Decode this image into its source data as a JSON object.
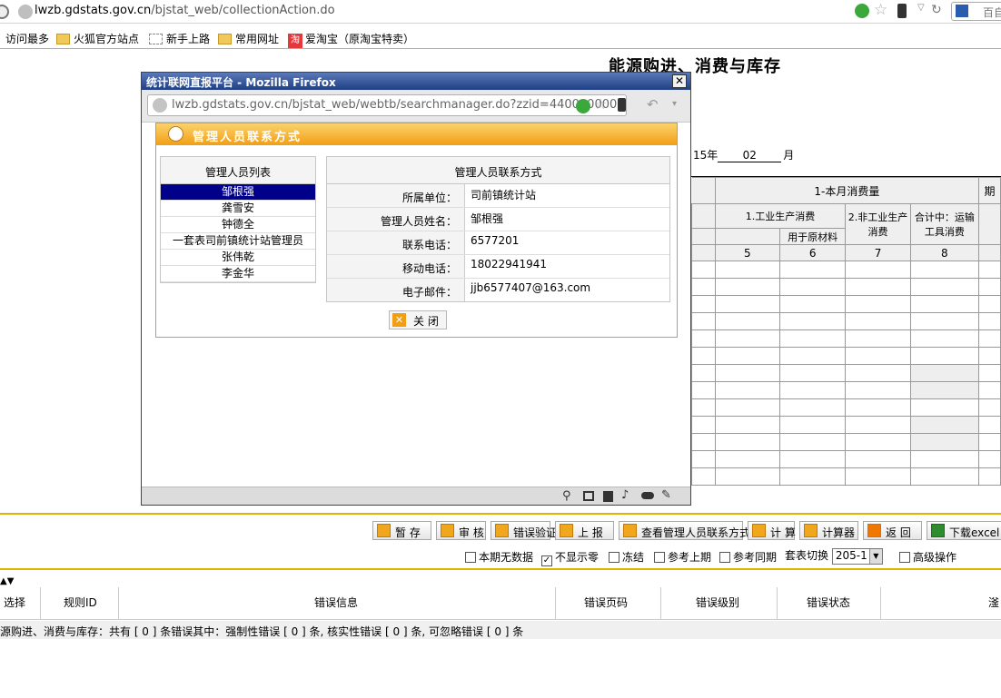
{
  "browser": {
    "url_domain": "lwzb.gdstats.gov.cn",
    "url_path": "/bjstat_web/collectionAction.do",
    "search_hint": "百自",
    "bookmarks": [
      "访问最多",
      "火狐官方站点",
      "新手上路",
      "常用网址",
      "爱淘宝（原淘宝特卖）"
    ],
    "taobao_badge": "淘"
  },
  "page": {
    "title": "能源购进、消费与库存",
    "period_year": "15年",
    "period_month_value": "02",
    "period_month_unit": "月",
    "grid": {
      "group_header": "1-本月消费量",
      "partial_header": "期",
      "col1": "1.工业生产消费",
      "col1_sub": "用于原材料",
      "col2": "2.非工业生产消费",
      "col3": "合计中：运输工具消费",
      "col_numbers": [
        "5",
        "6",
        "7",
        "8"
      ]
    }
  },
  "popup": {
    "window_title": "统计联网直报平台 - Mozilla Firefox",
    "url": "lwzb.gdstats.gov.cn/bjstat_web/webtb/searchmanager.do?zzid=4400000000",
    "panel_title": "管理人员联系方式",
    "list_title": "管理人员列表",
    "people": [
      "邹根强",
      "龚雪安",
      "钟德全",
      "一套表司前镇统计站管理员",
      "张伟乾",
      "李金华"
    ],
    "selected_index": 0,
    "info_title": "管理人员联系方式",
    "fields": [
      {
        "label": "所属单位：",
        "value": "司前镇统计站"
      },
      {
        "label": "管理人员姓名：",
        "value": "邹根强"
      },
      {
        "label": "联系电话：",
        "value": "6577201"
      },
      {
        "label": "移动电话：",
        "value": "18022941941"
      },
      {
        "label": "电子邮件：",
        "value": "jjb6577407@163.com"
      }
    ],
    "close_label": "关 闭"
  },
  "toolbar": {
    "buttons": [
      "暂 存",
      "审 核",
      "错误验证",
      "上 报",
      "查看管理人员联系方式",
      "计 算",
      "计算器",
      "返 回",
      "下载excel"
    ],
    "options": [
      {
        "label": "本期无数据",
        "checked": false
      },
      {
        "label": "不显示零",
        "checked": true
      },
      {
        "label": "冻结",
        "checked": false
      },
      {
        "label": "参考上期",
        "checked": false
      },
      {
        "label": "参考同期",
        "checked": false
      }
    ],
    "switch_label": "套表切换",
    "switch_value": "205-1",
    "advanced_label": "高级操作"
  },
  "errors": {
    "columns": [
      "选择",
      "规则ID",
      "错误信息",
      "错误页码",
      "错误级别",
      "错误状态",
      "滏"
    ],
    "summary": "源购进、消费与库存：共有 [ 0 ] 条错误其中：强制性错误 [ 0 ] 条, 核实性错误 [ 0 ] 条, 可忽略错误 [ 0 ] 条"
  }
}
